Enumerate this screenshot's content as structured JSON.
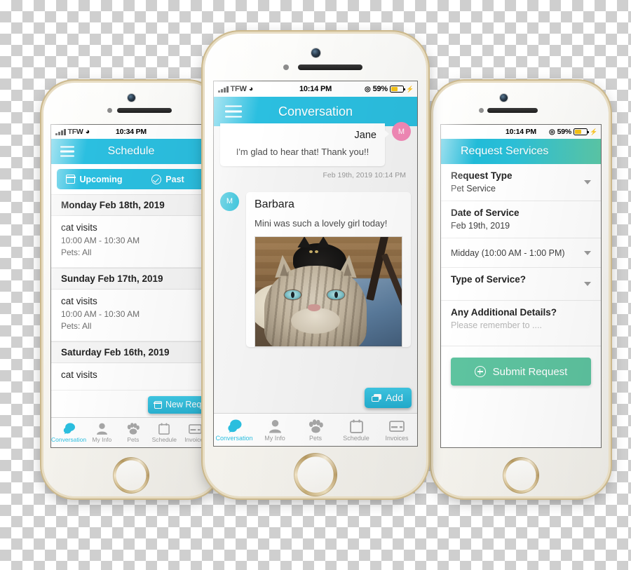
{
  "colors": {
    "brand_cyan": "#2bbfe0",
    "brand_green": "#5ec4a0",
    "avatar_pink": "#f389b7",
    "avatar_cyan": "#3ec4db",
    "battery_yellow": "#f6c316"
  },
  "phone_left": {
    "statusbar": {
      "carrier": "TFW",
      "time": "10:34 PM",
      "battery_percent": "",
      "wifi_icon": "wifi-icon",
      "signal_icon": "signal-bars-icon",
      "location_icon": "location-icon"
    },
    "appbar": {
      "title": "Schedule",
      "menu_icon": "hamburger-menu-icon"
    },
    "segments": [
      {
        "label": "Upcoming",
        "icon": "calendar-icon",
        "active": true
      },
      {
        "label": "Past",
        "icon": "check-circle-icon",
        "active": false
      }
    ],
    "groups": [
      {
        "day": "Monday Feb 18th, 2019",
        "visits": [
          {
            "title": "cat visits",
            "time": "10:00 AM - 10:30 AM",
            "pets": "Pets: All"
          }
        ]
      },
      {
        "day": "Sunday Feb 17th, 2019",
        "visits": [
          {
            "title": "cat visits",
            "time": "10:00 AM - 10:30 AM",
            "pets": "Pets: All"
          }
        ]
      },
      {
        "day": "Saturday Feb 16th, 2019",
        "visits": [
          {
            "title": "cat visits",
            "time": "",
            "pets": ""
          }
        ]
      }
    ],
    "new_request_button": {
      "label": "New Request",
      "icon": "calendar-plus-icon"
    },
    "tabs": [
      {
        "label": "Conversation",
        "icon": "chat-bubbles-icon",
        "active": true
      },
      {
        "label": "My Info",
        "icon": "person-icon",
        "active": false
      },
      {
        "label": "Pets",
        "icon": "paw-icon",
        "active": false
      },
      {
        "label": "Schedule",
        "icon": "calendar-icon",
        "active": false
      },
      {
        "label": "Invoices",
        "icon": "credit-card-icon",
        "active": false
      }
    ]
  },
  "phone_center": {
    "statusbar": {
      "carrier": "TFW",
      "time": "10:14 PM",
      "battery_percent": "59%",
      "wifi_icon": "wifi-icon",
      "signal_icon": "signal-bars-icon",
      "location_icon": "location-icon",
      "charging_icon": "lightning-bolt-icon"
    },
    "appbar": {
      "title": "Conversation",
      "menu_icon": "hamburger-menu-icon"
    },
    "messages": [
      {
        "sender": "Jane",
        "avatar_initial": "M",
        "avatar_color": "pink",
        "side": "right",
        "body": "I'm glad to hear that! Thank you!!",
        "timestamp": "Feb 19th, 2019 10:14 PM"
      },
      {
        "sender": "Barbara",
        "avatar_initial": "M",
        "avatar_color": "cyan",
        "side": "left",
        "body": "Mini was such a lovely girl today!",
        "has_photo": true,
        "photo_alt": "tabby cat with black cat in background"
      }
    ],
    "add_button": {
      "label": "Add",
      "icon": "media-attachment-icon"
    },
    "tabs": [
      {
        "label": "Conversation",
        "icon": "chat-bubbles-icon",
        "active": true
      },
      {
        "label": "My Info",
        "icon": "person-icon",
        "active": false
      },
      {
        "label": "Pets",
        "icon": "paw-icon",
        "active": false
      },
      {
        "label": "Schedule",
        "icon": "calendar-icon",
        "active": false
      },
      {
        "label": "Invoices",
        "icon": "credit-card-icon",
        "active": false
      }
    ]
  },
  "phone_right": {
    "statusbar": {
      "time": "10:14 PM",
      "battery_percent": "59%",
      "location_icon": "location-icon",
      "charging_icon": "lightning-bolt-icon"
    },
    "appbar": {
      "title": "Request Services"
    },
    "fields": [
      {
        "label": "Request Type",
        "value": "Pet Service",
        "caret": true
      },
      {
        "label": "Date of Service",
        "value": "Feb 19th, 2019",
        "caret": false
      },
      {
        "label": "",
        "value": "Midday (10:00 AM - 1:00 PM)",
        "caret": true
      },
      {
        "label": "Type of Service?",
        "value": "",
        "caret": true
      },
      {
        "label": "Any Additional Details?",
        "value": "Please remember to ....",
        "placeholder": true,
        "caret": false
      }
    ],
    "submit_button": {
      "label": "Submit Request",
      "icon": "plus-circle-icon"
    }
  }
}
